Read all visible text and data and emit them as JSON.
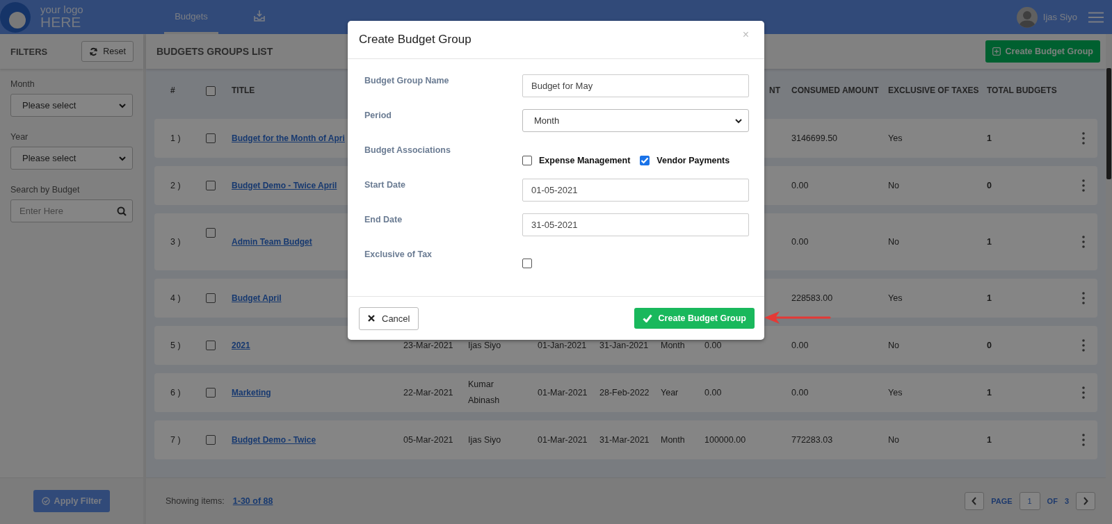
{
  "header": {
    "logo": {
      "line_1": "your logo",
      "line_2": "HERE"
    },
    "tabs": [
      {
        "kind": "text",
        "label": "Budgets",
        "selected": true
      },
      {
        "kind": "icon",
        "selected": false
      }
    ],
    "user": {
      "name": "Ijas Siyo"
    }
  },
  "filters": {
    "title": "FILTERS",
    "reset_button": "Reset",
    "fields": [
      {
        "kind": "select",
        "label": "Month",
        "value": "Please select"
      },
      {
        "kind": "select",
        "label": "Year",
        "value": "Please select"
      },
      {
        "kind": "search",
        "label": "Search by Budget",
        "placeholder": "Enter Here"
      }
    ],
    "apply_button": "Apply Filter"
  },
  "list": {
    "title": "BUDGETS GROUPS LIST",
    "create_button": "Create Budget Group",
    "table": {
      "header": {
        "number": "#",
        "select_all": {
          "checked": false
        },
        "title": "TITLE",
        "column_9": "NT",
        "consumed_amount": "CONSUMED AMOUNT",
        "exclusive_of_taxes": "EXCLUSIVE OF TAXES",
        "total_budgets": "TOTAL BUDGETS"
      },
      "rows": [
        {
          "number": "1 )",
          "checked": false,
          "title": "Budget for the Month of Apri",
          "consumed_amount": "3146699.50",
          "exclusive_of_taxes": "Yes",
          "total_budgets": "1"
        },
        {
          "number": "2 )",
          "checked": false,
          "title": "Budget Demo - Twice April",
          "consumed_amount": "0.00",
          "exclusive_of_taxes": "No",
          "total_budgets": "0"
        },
        {
          "number": "3 )",
          "checked": false,
          "title": "Admin Team Budget",
          "consumed_amount": "0.00",
          "exclusive_of_taxes": "No",
          "total_budgets": "1"
        },
        {
          "number": "4 )",
          "checked": false,
          "title": "Budget April",
          "consumed_amount": "228583.00",
          "exclusive_of_taxes": "Yes",
          "total_budgets": "1"
        },
        {
          "number": "5 )",
          "checked": false,
          "title": "2021",
          "column_4": "23-Mar-2021",
          "column_5": "Ijas Siyo",
          "column_6": "01-Jan-2021",
          "column_7": "31-Jan-2021",
          "column_8": "Month",
          "column_9": "0.00",
          "consumed_amount": "0.00",
          "exclusive_of_taxes": "No",
          "total_budgets": "0"
        },
        {
          "number": "6 )",
          "checked": false,
          "title": "Marketing",
          "column_4": "22-Mar-2021",
          "column_5": "Kumar Abinash",
          "column_6": "01-Mar-2021",
          "column_7": "28-Feb-2022",
          "column_8": "Year",
          "column_9": "0.00",
          "consumed_amount": "0.00",
          "exclusive_of_taxes": "Yes",
          "total_budgets": "1"
        },
        {
          "number": "7 )",
          "checked": false,
          "title": "Budget Demo - Twice",
          "column_4": "05-Mar-2021",
          "column_5": "Ijas Siyo",
          "column_6": "01-Mar-2021",
          "column_7": "31-Mar-2021",
          "column_8": "Month",
          "column_9": "100000.00",
          "consumed_amount": "772283.03",
          "exclusive_of_taxes": "No",
          "total_budgets": "1"
        }
      ]
    },
    "footer": {
      "showing_label": "Showing items:",
      "showing_link": "1-30 of 88",
      "page_label": "PAGE",
      "page_value": "1",
      "of_label": "OF",
      "total_pages": "3"
    }
  },
  "modal": {
    "title": "Create Budget Group",
    "close": "×",
    "fields": [
      {
        "kind": "text",
        "label": "Budget Group Name",
        "value": "Budget for May"
      },
      {
        "kind": "select",
        "label": "Period",
        "value": "Month"
      },
      {
        "kind": "checkboxes",
        "label": "Budget Associations",
        "options": [
          {
            "label": "Expense Management",
            "checked": false
          },
          {
            "label": "Vendor Payments",
            "checked": true
          }
        ]
      },
      {
        "kind": "text",
        "label": "Start Date",
        "value": "01-05-2021"
      },
      {
        "kind": "text",
        "label": "End Date",
        "value": "31-05-2021"
      },
      {
        "kind": "checkbox",
        "label": "Exclusive of Tax",
        "checked": false
      }
    ],
    "cancel_button": "Cancel",
    "submit_button": "Create Budget Group"
  }
}
